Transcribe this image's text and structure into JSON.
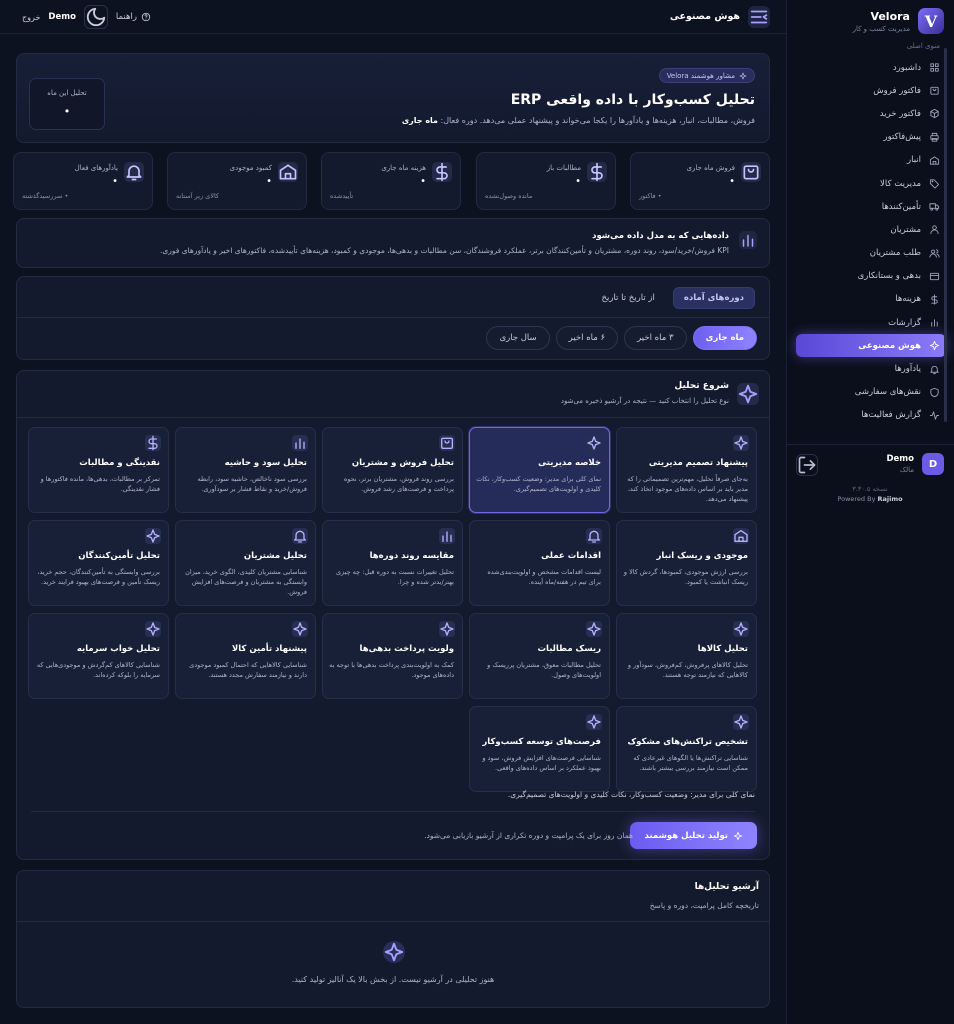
{
  "brand": {
    "name": "Velora",
    "subtitle": "مدیریت کسب و کار",
    "logo_letter": "V"
  },
  "sidebar": {
    "menu_title": "منوی اصلی",
    "items": [
      {
        "label": "داشبورد",
        "icon": "dashboard-icon"
      },
      {
        "label": "فاکتور فروش",
        "icon": "cart-icon"
      },
      {
        "label": "فاکتور خرید",
        "icon": "box-icon"
      },
      {
        "label": "پیش‌فاکتور",
        "icon": "printer-icon"
      },
      {
        "label": "انبار",
        "icon": "warehouse-icon"
      },
      {
        "label": "مدیریت کالا",
        "icon": "tag-icon"
      },
      {
        "label": "تأمین‌کنندها",
        "icon": "truck-icon"
      },
      {
        "label": "مشتریان",
        "icon": "user-icon"
      },
      {
        "label": "طلب مشتریان",
        "icon": "users-icon"
      },
      {
        "label": "بدهی و بستانکاری",
        "icon": "card-icon"
      },
      {
        "label": "هزینه‌ها",
        "icon": "dollar-icon"
      },
      {
        "label": "گزارشات",
        "icon": "bar-chart-icon"
      },
      {
        "label": "هوش مصنوعی",
        "icon": "ai-icon",
        "active": true
      },
      {
        "label": "یادآورها",
        "icon": "bell-icon"
      },
      {
        "label": "نقش‌های سفارشی",
        "icon": "shield-icon"
      },
      {
        "label": "گزارش فعالیت‌ها",
        "icon": "activity-icon"
      }
    ],
    "user": {
      "name": "Demo",
      "role": "مالک",
      "avatar_letter": "D"
    },
    "version": "نسخه ۳.۳۰.۵",
    "powered_prefix": "Powered By",
    "powered_brand": "Rajimo"
  },
  "topbar": {
    "title": "هوش مصنوعی",
    "help": "راهنما",
    "user": "Demo",
    "logout": "خروج"
  },
  "hero": {
    "badge": "مشاور هوشمند Velora",
    "title": "تحلیل کسب‌وکار با داده واقعی ERP",
    "desc": "فروش، مطالبات، انبار، هزینه‌ها و یادآورها را یکجا می‌خواند و پیشنهاد عملی می‌دهد. دوره فعال:",
    "period": "ماه جاری",
    "box_label": "تحلیل این ماه",
    "box_value": "•"
  },
  "stats": [
    {
      "label": "فروش ماه جاری",
      "value": "•",
      "sub": "• فاکتور",
      "icon": "cart-icon"
    },
    {
      "label": "مطالبات باز",
      "value": "•",
      "sub": "مانده وصول‌نشده",
      "icon": "dollar-icon"
    },
    {
      "label": "هزینه ماه جاری",
      "value": "•",
      "sub": "تأییدشده",
      "icon": "dollar-icon"
    },
    {
      "label": "کمبود موجودی",
      "value": "•",
      "sub": "کالای زیر آستانه",
      "icon": "warehouse-icon"
    },
    {
      "label": "یادآورهای فعال",
      "value": "•",
      "sub": "• سررسیدگذشته",
      "icon": "bell-icon"
    }
  ],
  "data_info": {
    "title": "داده‌هایی که به مدل داده می‌شود",
    "desc": "KPI فروش/خرید/سود، روند دوره، مشتریان و تأمین‌کنندگان برتر، عملکرد فروشندگان، سن مطالبات و بدهی‌ها، موجودی و کمبود، هزینه‌های تأییدشده، فاکتورهای اخیر و یادآورهای فوری."
  },
  "period": {
    "tabs": [
      {
        "label": "دوره‌های آماده",
        "active": true
      },
      {
        "label": "از تاریخ تا تاریخ"
      }
    ],
    "chips": [
      {
        "label": "ماه جاری",
        "active": true
      },
      {
        "label": "۳ ماه اخیر"
      },
      {
        "label": "۶ ماه اخیر"
      },
      {
        "label": "سال جاری"
      }
    ]
  },
  "analysis": {
    "title": "شروع تحلیل",
    "subtitle": "نوع تحلیل را انتخاب کنید — نتیجه در آرشیو ذخیره می‌شود",
    "options": [
      {
        "title": "پیشنهاد تصمیم مدیریتی",
        "desc": "به‌جای صرفاً تحلیل، مهم‌ترین تصمیماتی را که مدیر باید بر اساس داده‌های موجود اتخاذ کند، پیشنهاد می‌دهد.",
        "icon": "ai-icon"
      },
      {
        "title": "خلاصه مدیریتی",
        "desc": "نمای کلی برای مدیر: وضعیت کسب‌وکار، نکات کلیدی و اولویت‌های تصمیم‌گیری.",
        "icon": "ai-icon",
        "selected": true
      },
      {
        "title": "تحلیل فروش و مشتریان",
        "desc": "بررسی روند فروش، مشتریان برتر، نحوه پرداخت و فرصت‌های رشد فروش.",
        "icon": "cart-icon"
      },
      {
        "title": "تحلیل سود و حاشیه",
        "desc": "بررسی سود ناخالص، حاشیه سود، رابطه فروش/خرید و نقاط فشار بر سودآوری.",
        "icon": "bar-chart-icon"
      },
      {
        "title": "نقدینگی و مطالبات",
        "desc": "تمرکز بر مطالبات، بدهی‌ها، مانده فاکتورها و فشار نقدینگی.",
        "icon": "dollar-icon"
      },
      {
        "title": "موجودی و ریسک انبار",
        "desc": "بررسی ارزش موجودی، کمبودها، گردش کالا و ریسک انباشت یا کمبود.",
        "icon": "warehouse-icon"
      },
      {
        "title": "اقدامات عملی",
        "desc": "لیست اقدامات مشخص و اولویت‌بندی‌شده برای تیم در هفته/ماه آینده.",
        "icon": "bell-icon"
      },
      {
        "title": "مقایسه روند دوره‌ها",
        "desc": "تحلیل تغییرات نسبت به دوره قبل: چه چیزی بهتر/بدتر شده و چرا.",
        "icon": "bar-chart-icon"
      },
      {
        "title": "تحلیل مشتریان",
        "desc": "شناسایی مشتریان کلیدی، الگوی خرید، میزان وابستگی به مشتریان و فرصت‌های افزایش فروش.",
        "icon": "bell-icon"
      },
      {
        "title": "تحلیل تأمین‌کنندگان",
        "desc": "بررسی وابستگی به تأمین‌کنندگان، حجم خرید، ریسک تأمین و فرصت‌های بهبود فرایند خرید.",
        "icon": "ai-icon"
      },
      {
        "title": "تحلیل کالاها",
        "desc": "تحلیل کالاهای پرفروش، کم‌فروش، سودآور و کالاهایی که نیازمند توجه هستند.",
        "icon": "ai-icon"
      },
      {
        "title": "ریسک مطالبات",
        "desc": "تحلیل مطالبات معوق، مشتریان پرریسک و اولویت‌های وصول.",
        "icon": "ai-icon"
      },
      {
        "title": "ولویت پرداخت بدهی‌ها",
        "desc": "کمک به اولویت‌بندی پرداخت بدهی‌ها با توجه به داده‌های موجود.",
        "icon": "ai-icon"
      },
      {
        "title": "پیشنهاد تأمین کالا",
        "desc": "شناسایی کالاهایی که احتمال کمبود موجودی دارند و نیازمند سفارش مجدد هستند.",
        "icon": "ai-icon"
      },
      {
        "title": "تحلیل خواب سرمایه",
        "desc": "شناسایی کالاهای کم‌گردش و موجودی‌هایی که سرمایه را بلوکه کرده‌اند.",
        "icon": "ai-icon"
      },
      {
        "title": "تشخیص تراکنش‌های مشکوک",
        "desc": "شناسایی تراکنش‌ها یا الگوهای غیرعادی که ممکن است نیازمند بررسی بیشتر باشند.",
        "icon": "ai-icon"
      },
      {
        "title": "فرصت‌های توسعه کسب‌وکار",
        "desc": "شناسایی فرصت‌های افزایش فروش، سود و بهبود عملکرد بر اساس داده‌های واقعی.",
        "icon": "ai-icon"
      }
    ],
    "note": "نمای کلی برای مدیر: وضعیت کسب‌وکار، نکات کلیدی و اولویت‌های تصمیم‌گیری.",
    "generate": "تولید تحلیل هوشمند",
    "hint": "همان روز برای یک پرامپت و دوره تکراری از آرشیو بازیابی می‌شود."
  },
  "archive": {
    "title": "آرشیو تحلیل‌ها",
    "subtitle": "تاریخچه کامل پرامپت، دوره و پاسخ",
    "empty": "هنوز تحلیلی در آرشیو نیست. از بخش بالا یک آنالیز تولید کنید."
  }
}
